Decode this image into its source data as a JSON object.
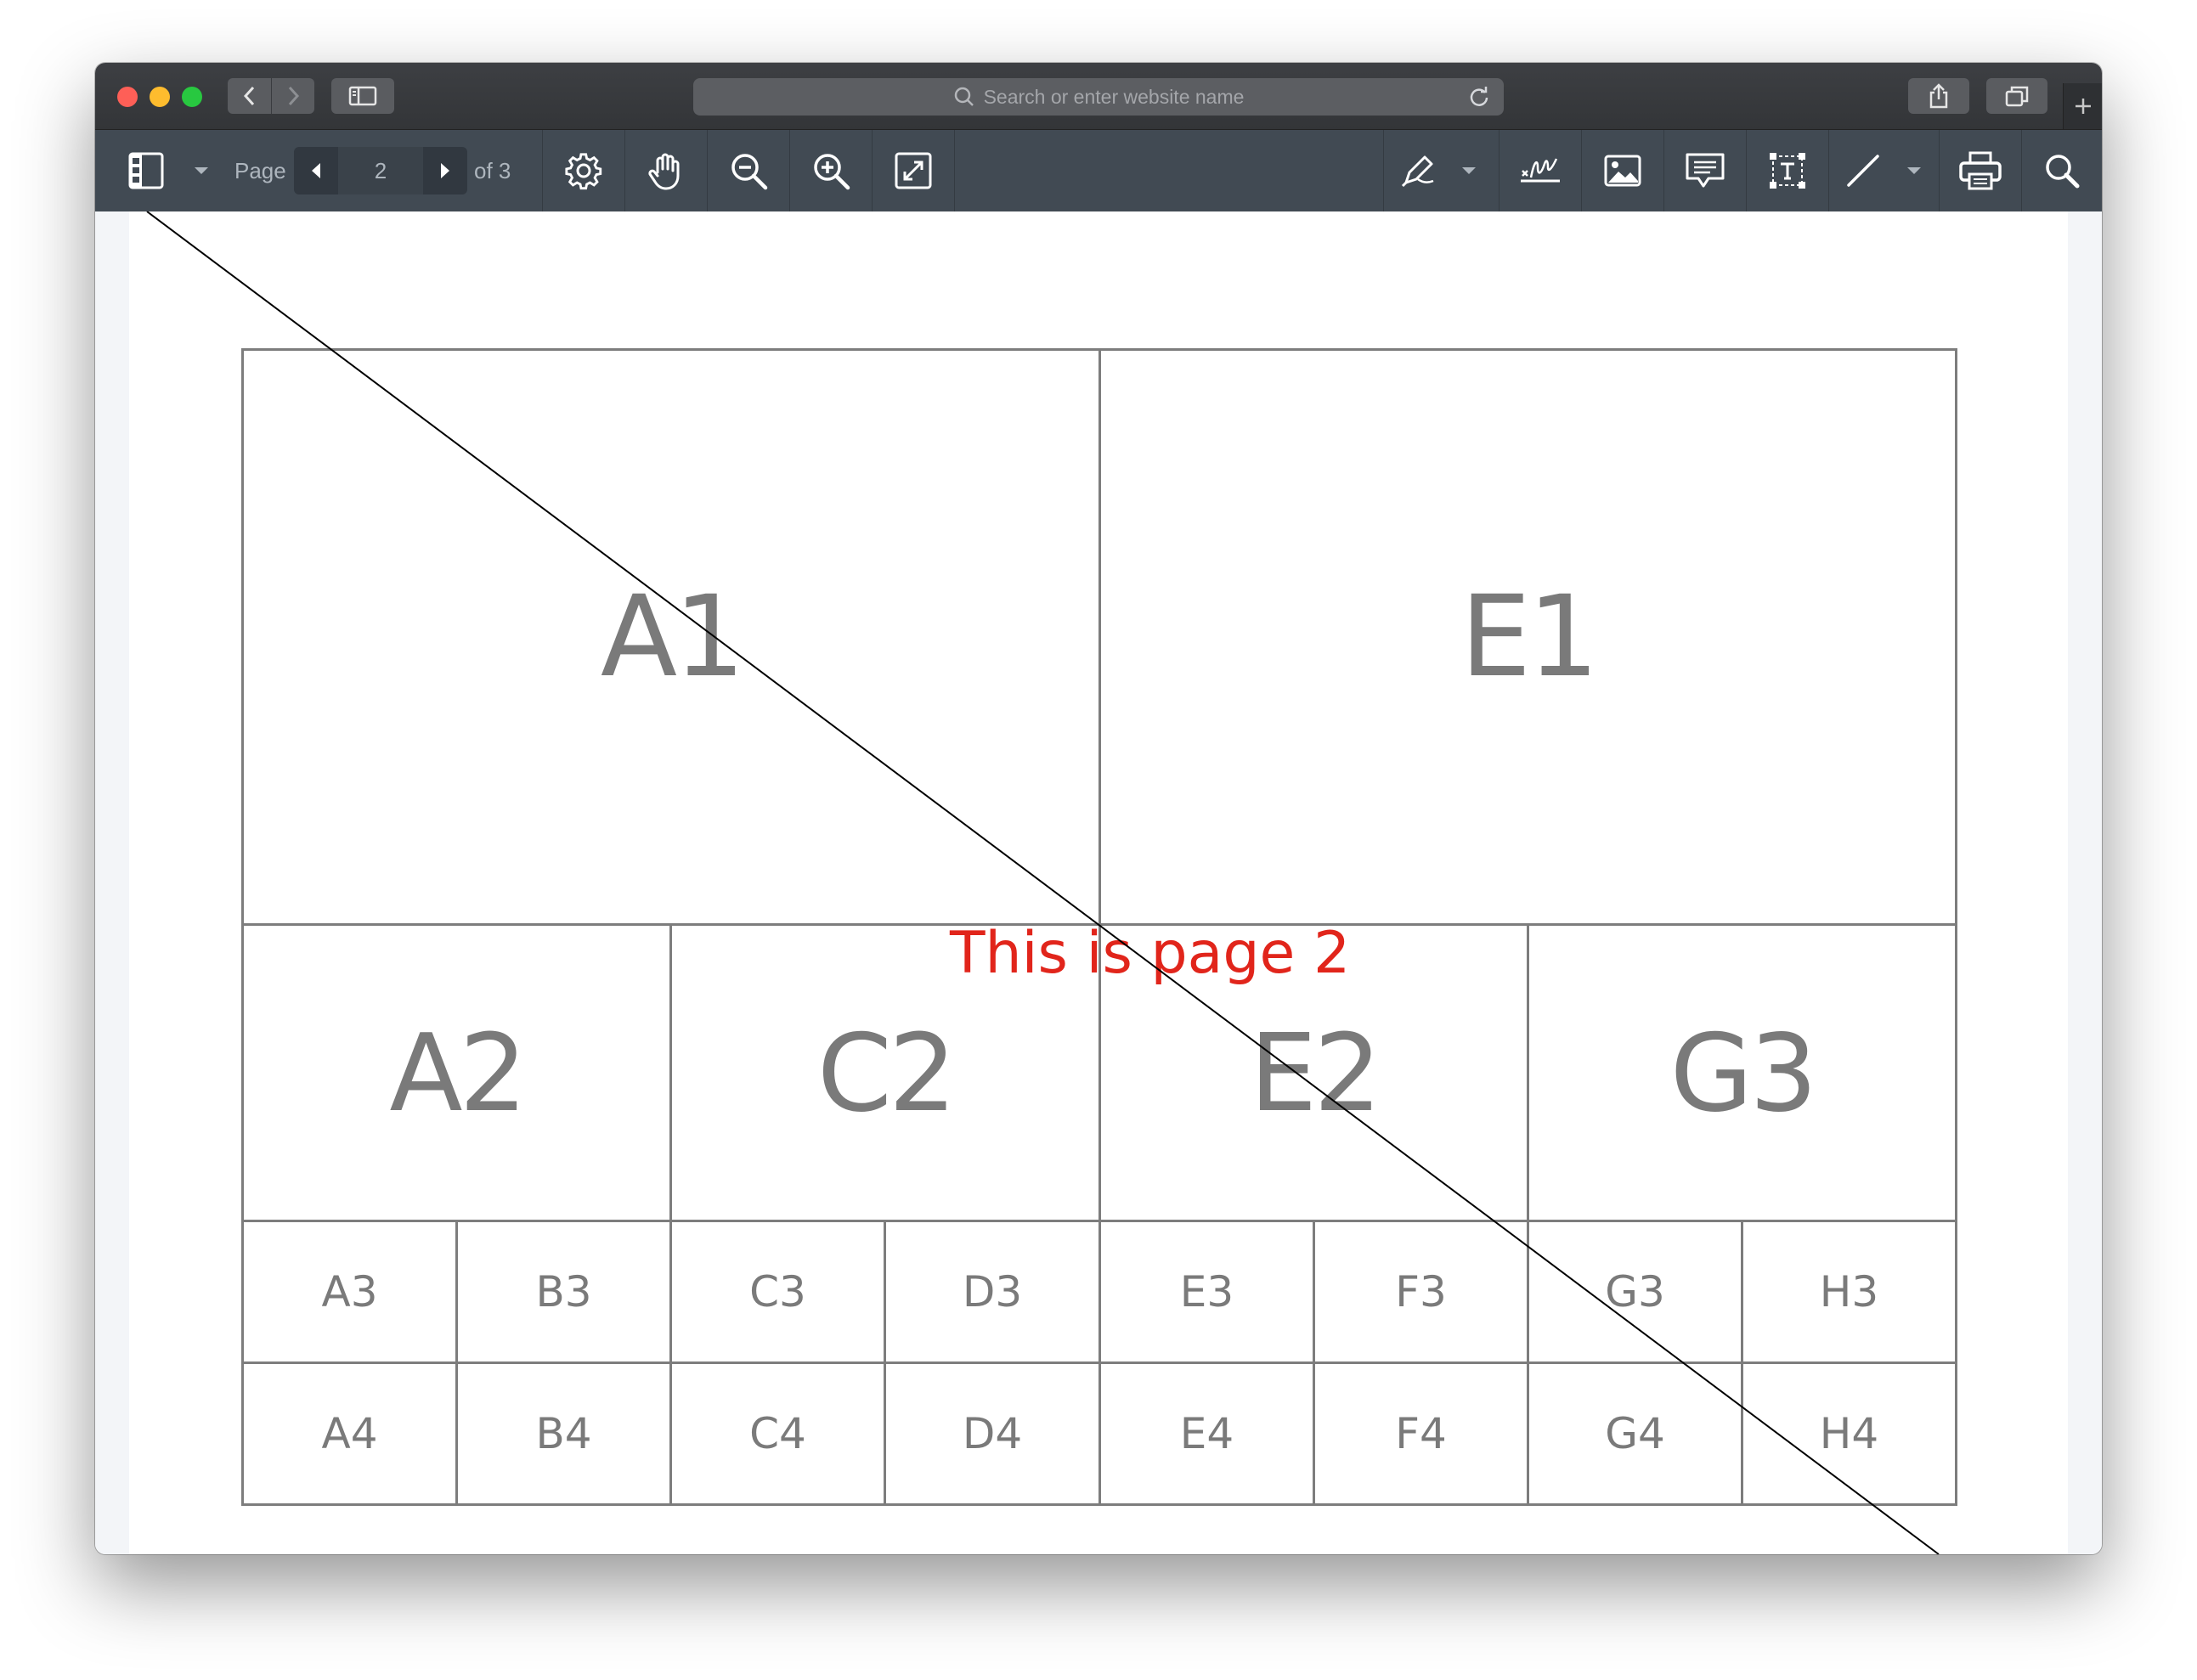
{
  "browser": {
    "address_bar": {
      "placeholder": "Search or enter website name"
    }
  },
  "pdf_toolbar": {
    "page_label": "Page",
    "current_page": "2",
    "total_pages_label": "of 3"
  },
  "document": {
    "annotation_text": "This is page 2",
    "annotation_color": "#e1251b",
    "row1": [
      "A1",
      "E1"
    ],
    "row2": [
      "A2",
      "C2",
      "E2",
      "G3"
    ],
    "row3": [
      "A3",
      "B3",
      "C3",
      "D3",
      "E3",
      "F3",
      "G3",
      "H3"
    ],
    "row4": [
      "A4",
      "B4",
      "C4",
      "D4",
      "E4",
      "F4",
      "G4",
      "H4"
    ]
  },
  "colors": {
    "toolbar": "#414a53",
    "titlebar": "#38393c",
    "grid_line": "#7d7d7d"
  }
}
